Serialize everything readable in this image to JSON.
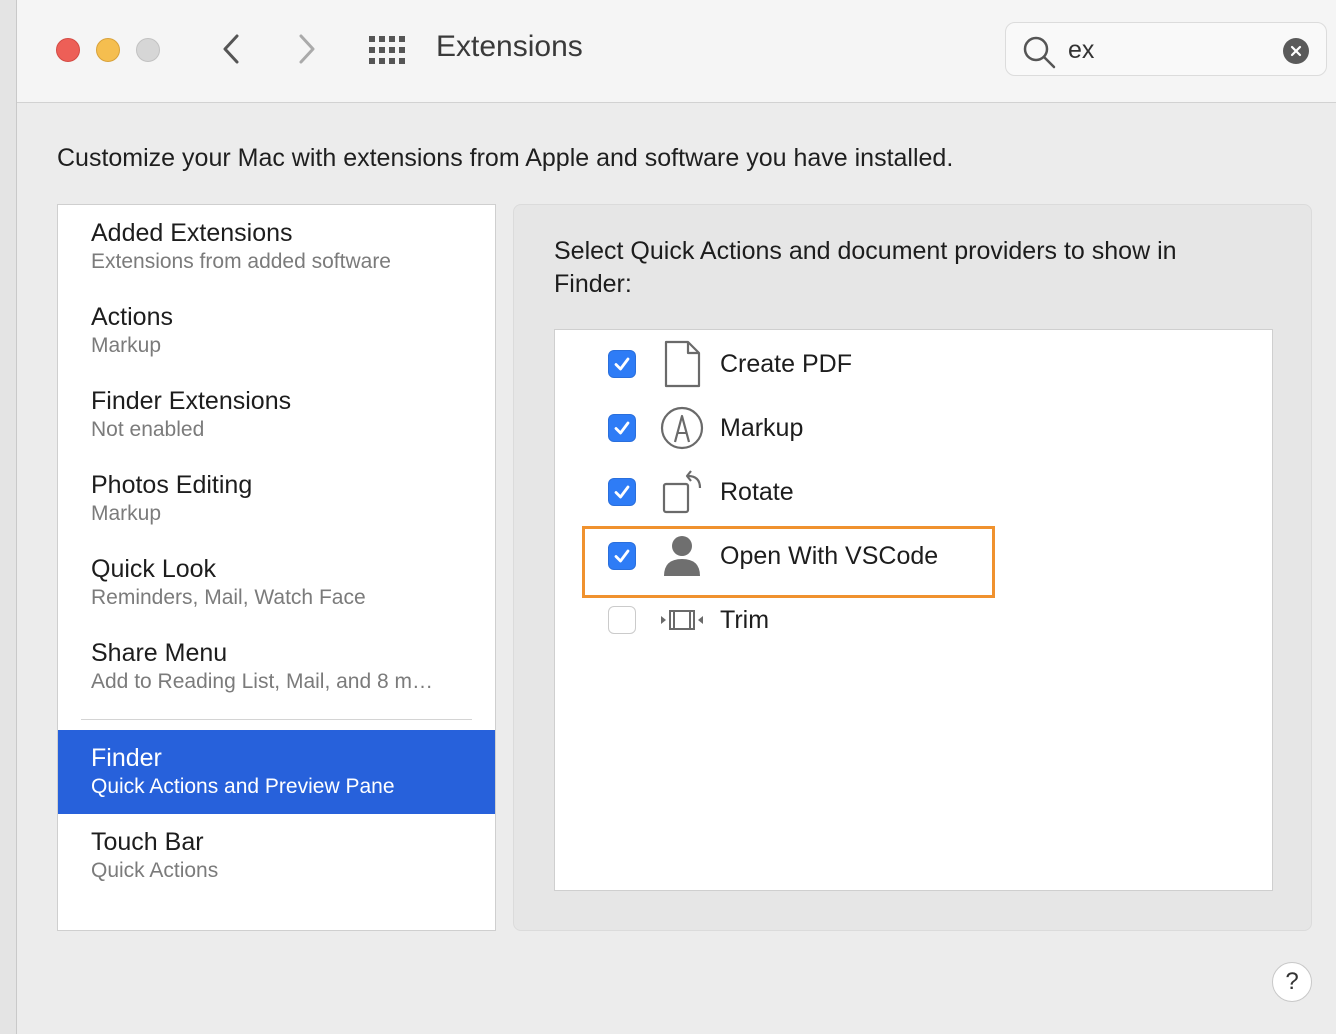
{
  "window": {
    "title": "Extensions"
  },
  "search": {
    "value": "ex"
  },
  "description": "Customize your Mac with extensions from Apple and software you have installed.",
  "sidebar": {
    "items": [
      {
        "label": "Added Extensions",
        "sub": "Extensions from added software"
      },
      {
        "label": "Actions",
        "sub": "Markup"
      },
      {
        "label": "Finder Extensions",
        "sub": "Not enabled"
      },
      {
        "label": "Photos Editing",
        "sub": "Markup"
      },
      {
        "label": "Quick Look",
        "sub": "Reminders, Mail, Watch Face"
      },
      {
        "label": "Share Menu",
        "sub": "Add to Reading List, Mail, and 8 m…"
      },
      {
        "label": "Finder",
        "sub": "Quick Actions and Preview Pane",
        "selected": true
      },
      {
        "label": "Touch Bar",
        "sub": "Quick Actions"
      }
    ]
  },
  "content": {
    "heading": "Select Quick Actions and document providers to show in Finder:",
    "actions": [
      {
        "label": "Create PDF",
        "checked": true,
        "icon": "document-icon"
      },
      {
        "label": "Markup",
        "checked": true,
        "icon": "markup-pen-icon"
      },
      {
        "label": "Rotate",
        "checked": true,
        "icon": "rotate-icon"
      },
      {
        "label": "Open With VSCode",
        "checked": true,
        "icon": "person-icon"
      },
      {
        "label": "Trim",
        "checked": false,
        "icon": "trim-film-icon"
      }
    ]
  },
  "help": {
    "label": "?"
  },
  "colors": {
    "accent": "#2761db",
    "checkbox": "#2e7cf6",
    "highlight": "#f0922e",
    "close": "#ed5f57",
    "minimize": "#f5be4f",
    "zoom": "#d6d6d6"
  }
}
